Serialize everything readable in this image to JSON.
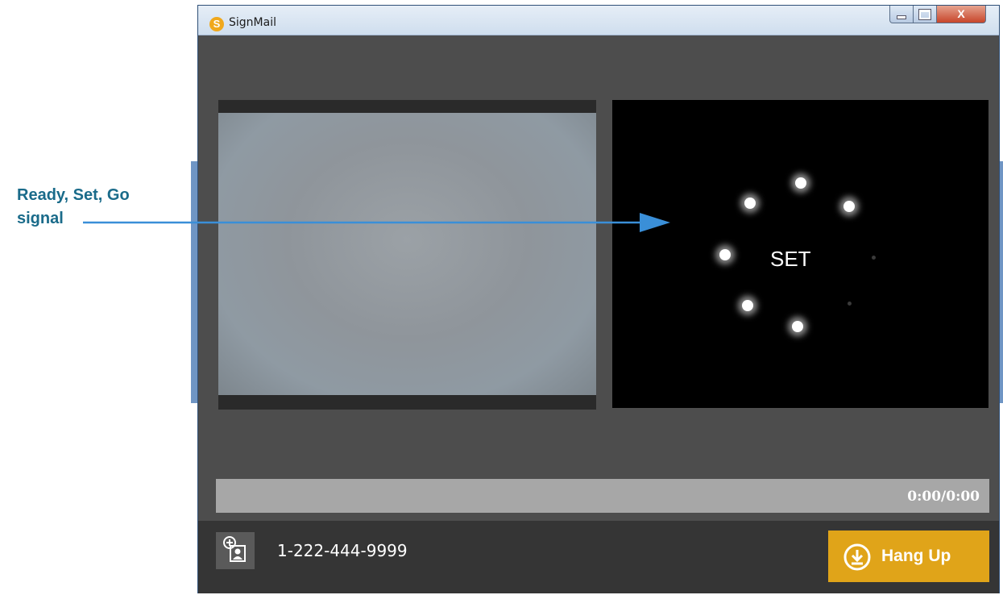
{
  "annotation": {
    "label_line1": "Ready, Set, Go",
    "label_line2": "signal",
    "arrow_color": "#3a8fd8"
  },
  "window": {
    "title": "SignMail",
    "app_icon_letter": "S",
    "controls": {
      "minimize": "minimize",
      "maximize": "maximize",
      "close": "X"
    }
  },
  "countdown": {
    "text": "SET",
    "lit_dots": 6,
    "total_dots": 8
  },
  "playback": {
    "time": "0:00/0:00"
  },
  "contact": {
    "phone_number": "1-222-444-9999",
    "add_contact_icon": "add-contact-icon"
  },
  "hangup": {
    "label": "Hang Up",
    "icon": "download-circle-icon",
    "color": "#e0a419"
  }
}
